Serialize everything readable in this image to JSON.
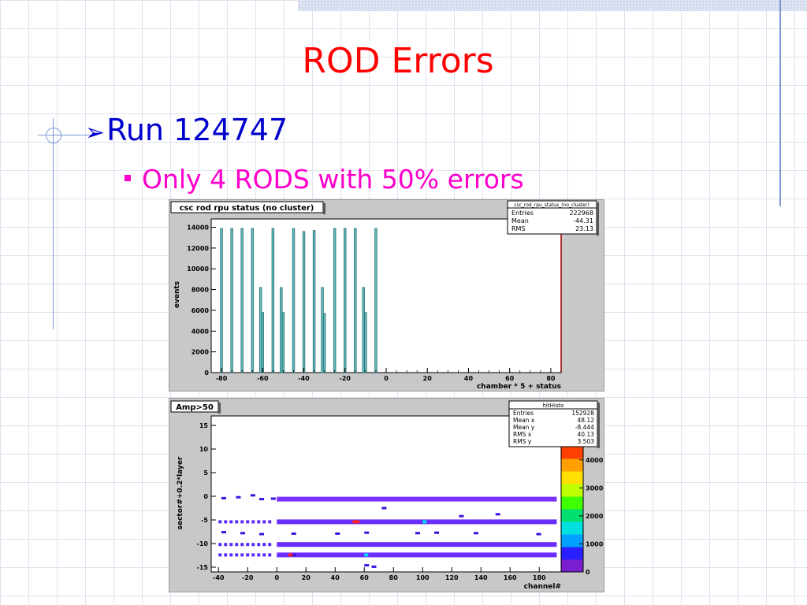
{
  "slide": {
    "title": "ROD Errors",
    "bullet1": "Run 124747",
    "bullet2": "Only 4 RODS with 50% errors"
  },
  "plot1": {
    "title": "csc rod rpu status (no cluster)",
    "stats_title": "csc_rod_rpu_status_(no_cluster)",
    "stats": [
      {
        "label": "Entries",
        "value": "222968"
      },
      {
        "label": "Mean",
        "value": "-44.31"
      },
      {
        "label": "RMS",
        "value": "23.13"
      }
    ],
    "xlabel": "chamber * 5 + status",
    "ylabel": "events"
  },
  "plot2": {
    "title": "Amp>50",
    "stats_title": "hitHisto",
    "stats": [
      {
        "label": "Entries",
        "value": "152928"
      },
      {
        "label": "Mean x",
        "value": "48.12"
      },
      {
        "label": "Mean y",
        "value": "-8.444"
      },
      {
        "label": "RMS x",
        "value": "40.13"
      },
      {
        "label": "RMS y",
        "value": "3.503"
      }
    ],
    "xlabel": "channel#",
    "ylabel": "sector#+0.2*layer",
    "colorbar_ticks": [
      "0",
      "1000",
      "2000",
      "3000",
      "4000"
    ]
  },
  "chart_data": [
    {
      "type": "bar",
      "title": "csc rod rpu status (no cluster)",
      "xlabel": "chamber * 5 + status",
      "ylabel": "events",
      "xlim": [
        -85,
        85
      ],
      "ylim": [
        0,
        14800
      ],
      "xticks": [
        -80,
        -60,
        -40,
        -20,
        0,
        20,
        40,
        60,
        80
      ],
      "yticks": [
        0,
        2000,
        4000,
        6000,
        8000,
        10000,
        12000,
        14000
      ],
      "x": [
        -80,
        -75,
        -70,
        -65,
        -61,
        -60,
        -55,
        -51,
        -50,
        -45,
        -40,
        -35,
        -31,
        -30,
        -25,
        -20,
        -15,
        -11,
        -10,
        -5
      ],
      "values": [
        13900,
        13900,
        13900,
        13900,
        8200,
        5800,
        13900,
        8200,
        5800,
        13900,
        13600,
        13700,
        8200,
        5700,
        13900,
        13900,
        13900,
        8200,
        5800,
        13900
      ]
    },
    {
      "type": "heatmap",
      "title": "Amp>50",
      "xlabel": "channel#",
      "ylabel": "sector#+0.2*layer",
      "xlim": [
        -45,
        195
      ],
      "ylim": [
        -16,
        17
      ],
      "xticks": [
        -40,
        -20,
        0,
        20,
        40,
        60,
        80,
        100,
        120,
        140,
        160,
        180
      ],
      "yticks": [
        -15,
        -10,
        -5,
        0,
        5,
        10,
        15
      ],
      "colorbar_range": [
        0,
        4500
      ],
      "bands": [
        {
          "y": -0.6,
          "x_start": 0,
          "x_end": 192
        },
        {
          "y": -5.4,
          "x_start": -40,
          "x_end": 192
        },
        {
          "y": -10.2,
          "x_start": -40,
          "x_end": 192
        },
        {
          "y": -12.4,
          "x_start": -40,
          "x_end": 192
        }
      ]
    }
  ]
}
